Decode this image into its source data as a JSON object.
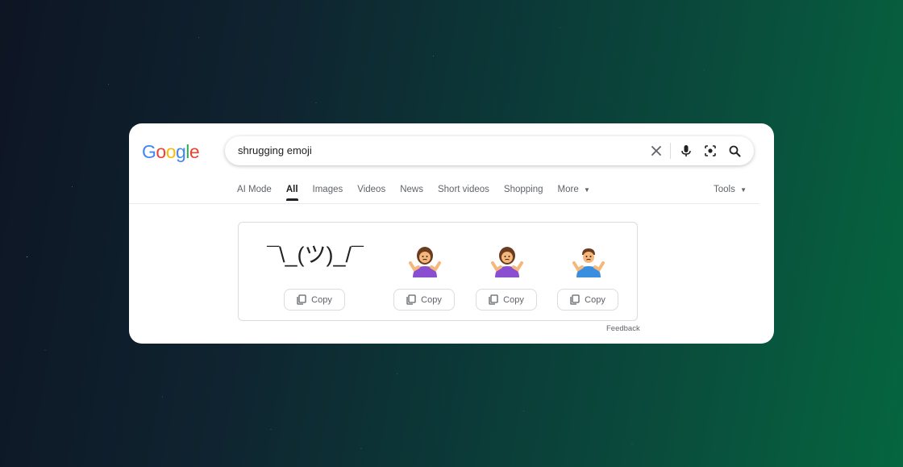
{
  "logo": {
    "letters": [
      "G",
      "o",
      "o",
      "g",
      "l",
      "e"
    ],
    "colors": [
      "#4285F4",
      "#EA4335",
      "#FBBC05",
      "#4285F4",
      "#34A853",
      "#EA4335"
    ]
  },
  "search": {
    "query": "shrugging emoji"
  },
  "icons": {
    "clear": "close-icon",
    "voice": "mic-icon",
    "lens": "camera-lens-icon",
    "search": "search-icon",
    "copy": "copy-icon",
    "dropdown": "caret-down-icon"
  },
  "tabs": [
    "AI Mode",
    "All",
    "Images",
    "Videos",
    "News",
    "Short videos",
    "Shopping",
    "More"
  ],
  "active_tab": "All",
  "tools_label": "Tools",
  "results": {
    "items": [
      {
        "glyph": "¯\\_(ツ)_/¯",
        "copy_label": "Copy"
      },
      {
        "glyph": "person-shrugging-female-purple",
        "copy_label": "Copy"
      },
      {
        "glyph": "person-shrugging-female-purple",
        "copy_label": "Copy"
      },
      {
        "glyph": "person-shrugging-male-blue",
        "copy_label": "Copy"
      }
    ]
  },
  "feedback_label": "Feedback"
}
